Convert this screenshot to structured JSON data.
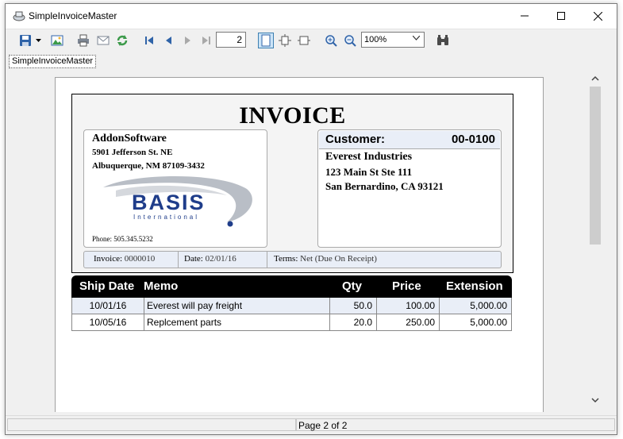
{
  "window": {
    "title": "SimpleInvoiceMaster"
  },
  "toolbar": {
    "page_number": "2",
    "zoom": "100%"
  },
  "tab": {
    "label": "SimpleInvoiceMaster"
  },
  "invoice": {
    "title": "INVOICE",
    "from": {
      "name": "AddonSoftware",
      "address1": "5901 Jefferson St. NE",
      "address2": "Albuquerque, NM  87109-3432",
      "logo_text": "BASIS",
      "logo_sub": "International",
      "phone": "Phone: 505.345.5232"
    },
    "customer": {
      "label": "Customer:",
      "id": "00-0100",
      "name": "Everest Industries",
      "address1": "123 Main St Ste 111",
      "address2": "San Bernardino, CA  93121"
    },
    "info": {
      "invoice_label": "Invoice:",
      "invoice_value": "0000010",
      "date_label": "Date:",
      "date_value": "02/01/16",
      "terms_label": "Terms:",
      "terms_value": "Net (Due On Receipt)"
    },
    "columns": [
      "Ship Date",
      "Memo",
      "Qty",
      "Price",
      "Extension"
    ],
    "rows": [
      {
        "ship_date": "10/01/16",
        "memo": "Everest will pay freight",
        "qty": "50.0",
        "price": "100.00",
        "extension": "5,000.00"
      },
      {
        "ship_date": "10/05/16",
        "memo": "Replcement parts",
        "qty": "20.0",
        "price": "250.00",
        "extension": "5,000.00"
      }
    ]
  },
  "status": {
    "page": "Page 2 of 2"
  }
}
